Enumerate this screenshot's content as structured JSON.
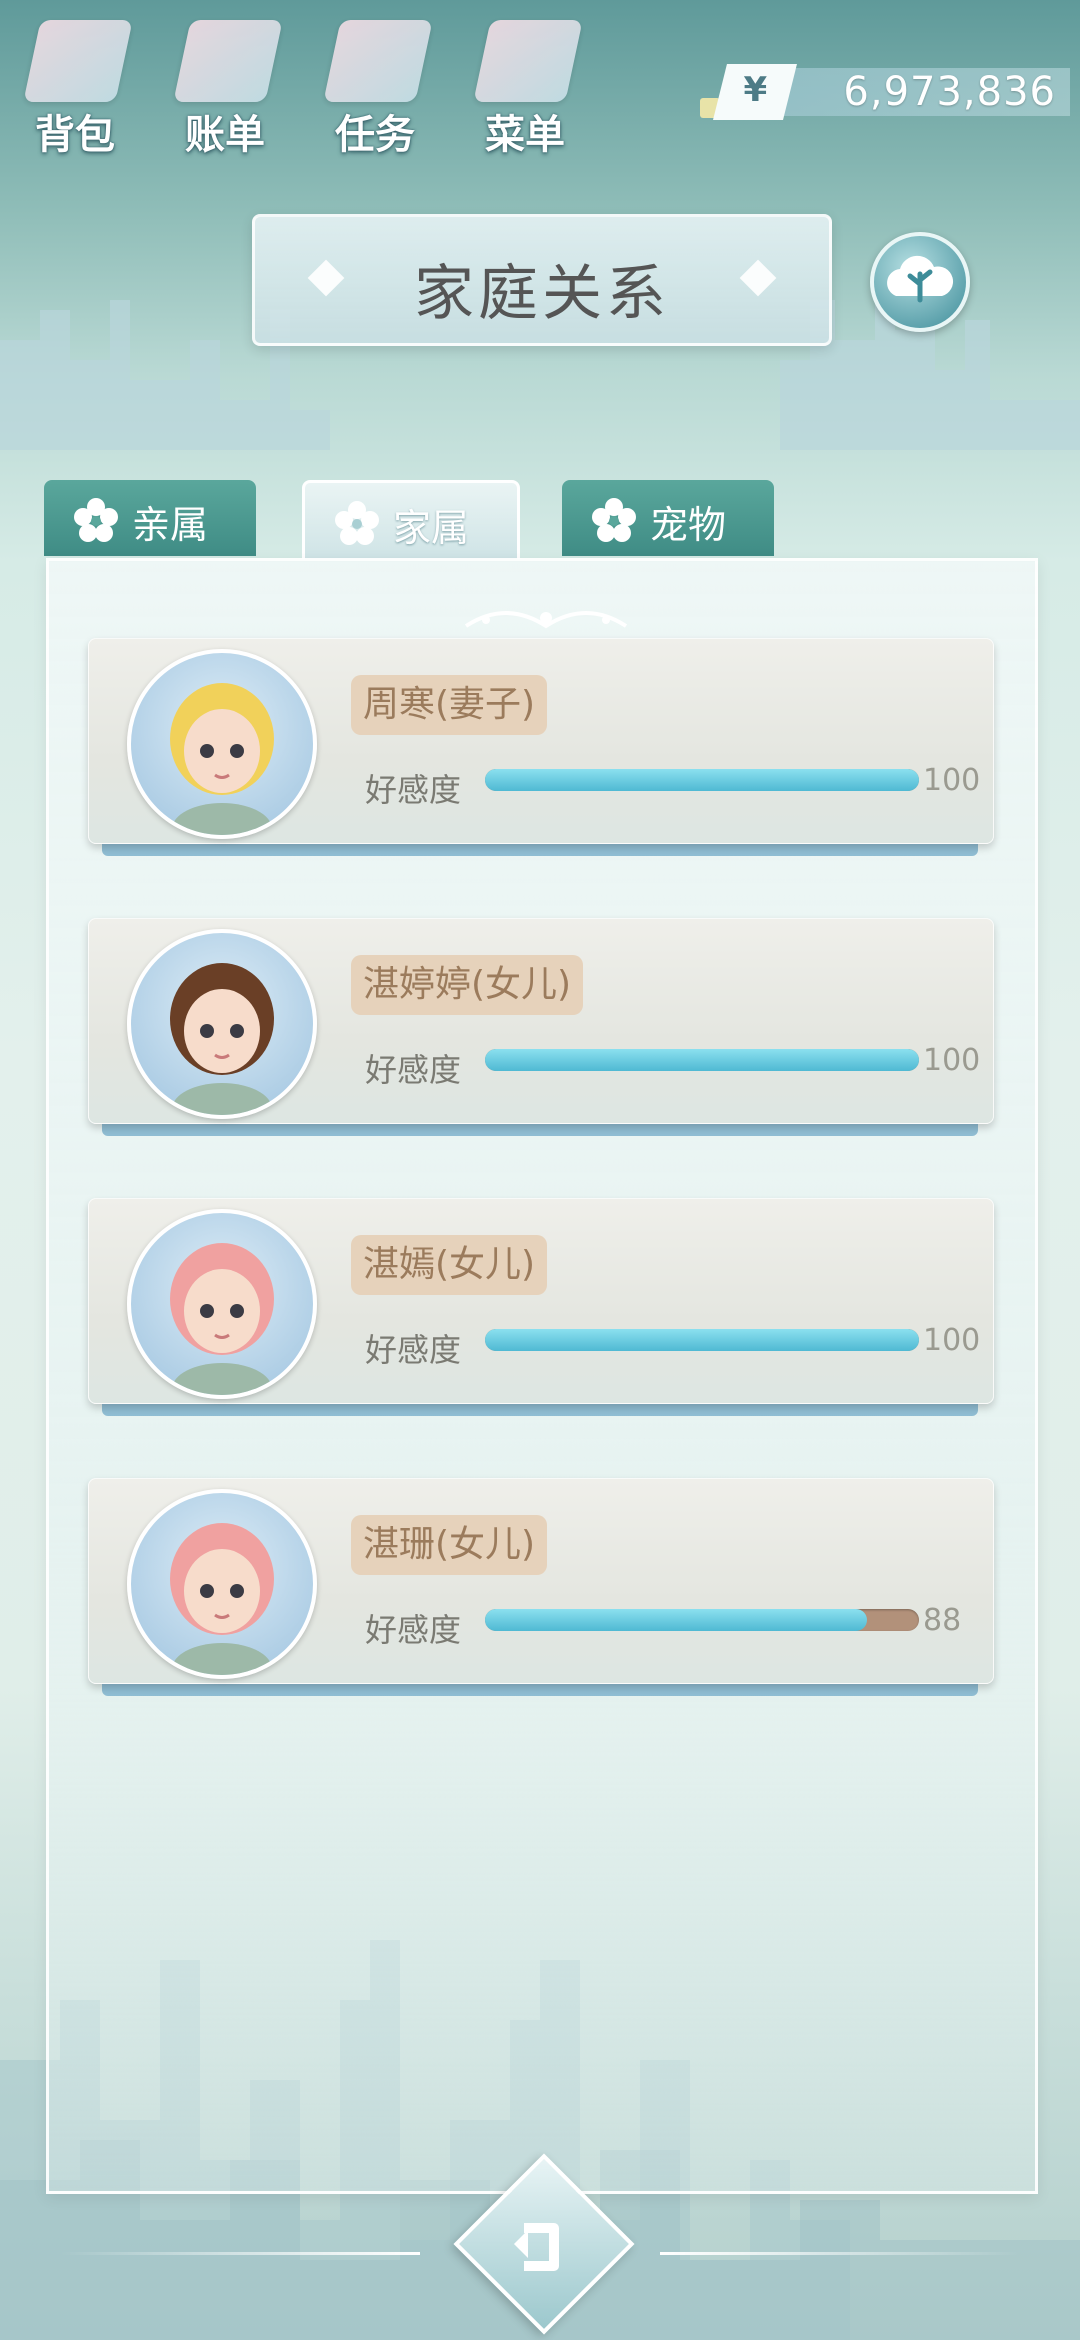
{
  "topbar": {
    "items": [
      {
        "label": "背包",
        "icon": "backpack-icon"
      },
      {
        "label": "账单",
        "icon": "bill-icon"
      },
      {
        "label": "任务",
        "icon": "task-icon"
      },
      {
        "label": "菜单",
        "icon": "menu-icon"
      }
    ],
    "currency_symbol": "¥",
    "money": "6,973,836"
  },
  "header": {
    "title": "家庭关系"
  },
  "tabs": [
    {
      "label": "亲属",
      "active": false
    },
    {
      "label": "家属",
      "active": true
    },
    {
      "label": "宠物",
      "active": false
    }
  ],
  "members": [
    {
      "name": "周寒(妻子)",
      "affection_label": "好感度",
      "affection": 100,
      "hair": "#f1d15a"
    },
    {
      "name": "湛婷婷(女儿)",
      "affection_label": "好感度",
      "affection": 100,
      "hair": "#6a3f26"
    },
    {
      "name": "湛嫣(女儿)",
      "affection_label": "好感度",
      "affection": 100,
      "hair": "#f0a1a0"
    },
    {
      "name": "湛珊(女儿)",
      "affection_label": "好感度",
      "affection": 88,
      "hair": "#f0a1a0"
    }
  ],
  "colors": {
    "affection_fill": "#4fb9d3",
    "affection_empty": "#b2917a"
  }
}
